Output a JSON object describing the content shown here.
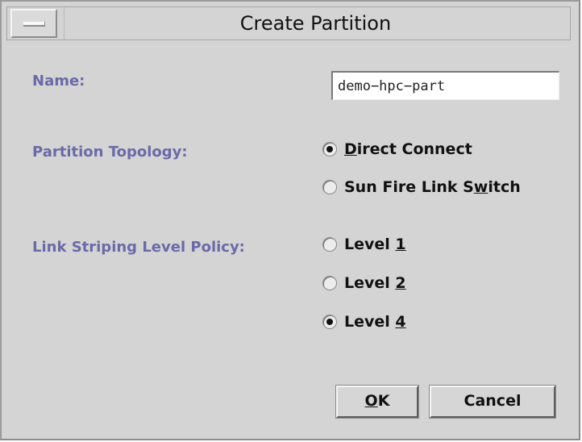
{
  "window": {
    "title": "Create Partition"
  },
  "form": {
    "name_label": "Name:",
    "name_value": "demo−hpc−part",
    "topology_label": "Partition Topology:",
    "topology_options": [
      {
        "pre": "",
        "mnemonic": "D",
        "post": "irect Connect",
        "selected": true
      },
      {
        "pre": "Sun Fire Link S",
        "mnemonic": "w",
        "post": "itch",
        "selected": false
      }
    ],
    "striping_label": "Link Striping Level Policy:",
    "striping_options": [
      {
        "pre": "Level ",
        "mnemonic": "1",
        "post": "",
        "selected": false
      },
      {
        "pre": "Level ",
        "mnemonic": "2",
        "post": "",
        "selected": false
      },
      {
        "pre": "Level ",
        "mnemonic": "4",
        "post": "",
        "selected": true
      }
    ]
  },
  "buttons": {
    "ok": {
      "mnemonic": "O",
      "post": "K"
    },
    "cancel": {
      "label": "Cancel"
    }
  },
  "colors": {
    "label": "#6a6aa8",
    "background": "#d4d4d4"
  },
  "icons": {
    "window_menu": "window-menu-icon"
  }
}
